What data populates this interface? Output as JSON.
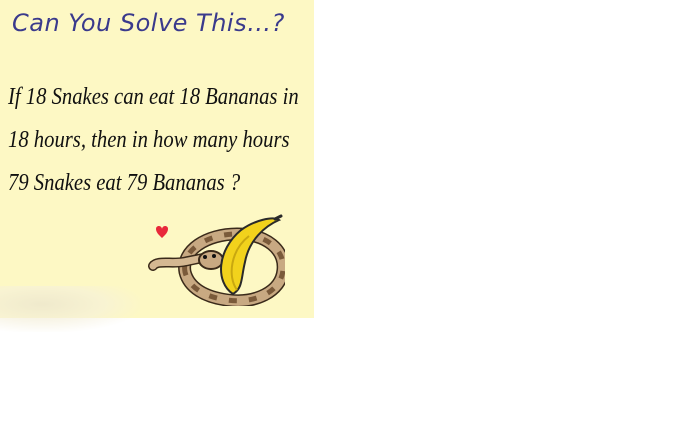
{
  "title": "Can You Solve This…?",
  "question": {
    "line1": "If 18 Snakes can eat 18 Bananas in",
    "line2": "18 hours, then in how many hours",
    "line3": "79 Snakes eat 79 Bananas ?"
  },
  "icons": [
    "heart-icon",
    "snake-illustration",
    "banana-illustration"
  ],
  "colors": {
    "card_background": "#fdf8c4",
    "title_text": "#3a3a8c",
    "body_text": "#111111",
    "heart": "#e8283a",
    "banana": "#f2d21c",
    "snake": "#8a6a4a"
  }
}
